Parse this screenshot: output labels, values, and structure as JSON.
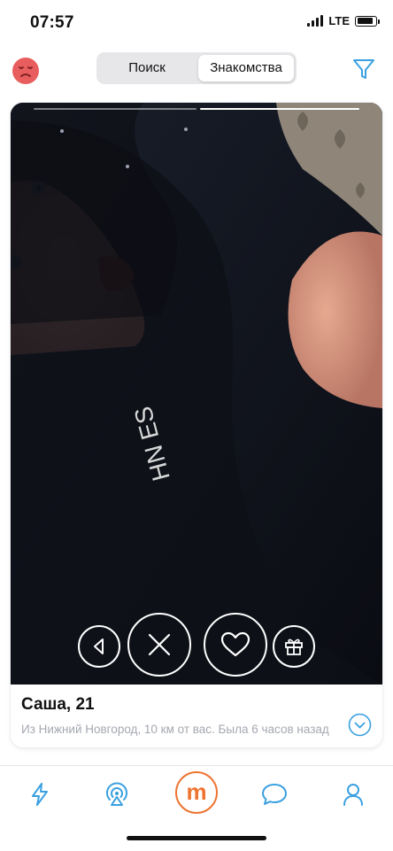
{
  "status_bar": {
    "time": "07:57",
    "network": "LTE",
    "battery_level": 0.85
  },
  "header": {
    "mood_icon": "sad-face-icon",
    "tabs": [
      {
        "label": "Поиск",
        "active": false
      },
      {
        "label": "Знакомства",
        "active": true
      }
    ],
    "filter_icon": "filter-icon"
  },
  "profile_card": {
    "photo_count": 2,
    "active_photo_index": 1,
    "name_age": "Саша, 21",
    "subtitle": "Из Нижний Новгород, 10 км от вас. Была 6 часов назад",
    "actions": [
      "back-icon",
      "close-icon",
      "heart-icon",
      "gift-icon"
    ]
  },
  "tab_bar": {
    "items": [
      "lightning-icon",
      "radar-icon",
      "mamba-logo-icon",
      "chat-bubble-icon",
      "profile-icon"
    ],
    "center_letter": "m",
    "active_index": 2
  },
  "colors": {
    "accent": "#ee7431",
    "blue_icons": "#3aa0e0",
    "mood_red": "#e85d5d",
    "subtitle_gray": "#a4a8b0"
  }
}
